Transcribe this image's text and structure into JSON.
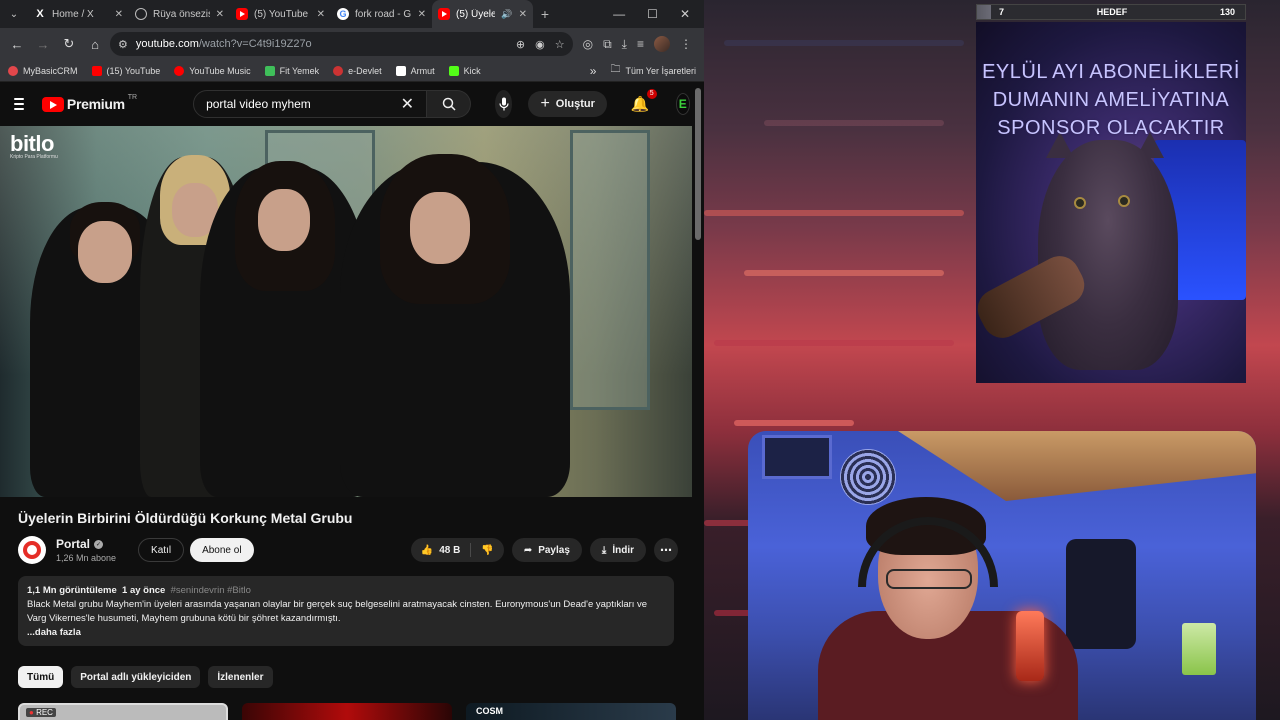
{
  "browser": {
    "tabs": [
      {
        "title": "Home / X",
        "favicon": "x-icon",
        "active": false
      },
      {
        "title": "Rüya önsezis",
        "favicon": "globe-icon",
        "active": false
      },
      {
        "title": "(5) YouTube",
        "favicon": "youtube-icon",
        "active": false
      },
      {
        "title": "fork road - G",
        "favicon": "google-icon",
        "active": false
      },
      {
        "title": "(5) Üyele",
        "favicon": "youtube-icon",
        "active": true
      }
    ],
    "url_host": "youtube.com",
    "url_path": "/watch?v=C4t9i19Z27o",
    "bookmarks": [
      {
        "label": "MyBasicCRM",
        "color": "#e2474b"
      },
      {
        "label": "(15) YouTube",
        "color": "#ff0000"
      },
      {
        "label": "YouTube Music",
        "color": "#ff0000"
      },
      {
        "label": "Fit Yemek",
        "color": "#3fbf5a"
      },
      {
        "label": "e-Devlet",
        "color": "#c33"
      },
      {
        "label": "Armut",
        "color": "#ffffff"
      },
      {
        "label": "Kick",
        "color": "#53fc18"
      }
    ],
    "bookmarks_more": "»",
    "all_bookmarks": "Tüm Yer İşaretleri"
  },
  "youtube": {
    "logo_text": "Premium",
    "region": "TR",
    "search_value": "portal video myhem",
    "create_label": "Oluştur",
    "notifications": "5",
    "account_initial": "E",
    "watermark": "bitlo",
    "watermark_sub": "Kripto Para Platformu",
    "video_title": "Üyelerin Birbirini Öldürdüğü Korkunç Metal Grubu",
    "channel": {
      "name": "Portal",
      "subs": "1,26 Mn abone"
    },
    "join_label": "Katıl",
    "subscribe_label": "Abone ol",
    "likes": "48 B",
    "share_label": "Paylaş",
    "download_label": "İndir",
    "description": {
      "views": "1,1 Mn görüntüleme",
      "age": "1 ay önce",
      "tags": "#senindevrin #Bitlo",
      "body": "Black Metal grubu Mayhem'in üyeleri arasında yaşanan olaylar bir gerçek suç belgeselini aratmayacak cinsten. Euronymous'un Dead'e yaptıkları ve Varg Vikernes'le husumeti, Mayhem grubuna kötü bir şöhret kazandırmıştı.",
      "more": "...daha fazla"
    },
    "chips": [
      {
        "label": "Tümü",
        "active": true
      },
      {
        "label": "Portal adlı yükleyiciden",
        "active": false
      },
      {
        "label": "İzlenenler",
        "active": false
      }
    ],
    "thumb_rec": "REC",
    "thumb_cosm": "COSM"
  },
  "stream": {
    "goal_current": "7",
    "goal_label": "HEDEF",
    "goal_target": "130",
    "goal_progress": 0.054,
    "announcement": "EYLÜL AYI ABONELİKLERİ DUMANIN AMELİYATINA SPONSOR OLACAKTIR",
    "colors": {
      "accent": "#ff0000",
      "overlay_text": "#c7c4ff"
    }
  }
}
